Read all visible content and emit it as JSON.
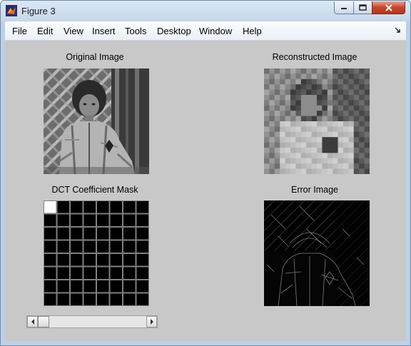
{
  "window": {
    "title": "Figure 3"
  },
  "menu": [
    "File",
    "Edit",
    "View",
    "Insert",
    "Tools",
    "Desktop",
    "Window",
    "Help"
  ],
  "panels": {
    "original": {
      "title": "Original Image"
    },
    "reconstructed": {
      "title": "Reconstructed Image"
    },
    "mask": {
      "title": "DCT Coefficient Mask",
      "grid_size": 8,
      "selected_cells": [
        [
          0,
          0
        ]
      ]
    },
    "error": {
      "title": "Error Image"
    }
  },
  "slider": {
    "value_fraction": 0.0
  },
  "colors": {
    "figure_bg": "#c8c8c8",
    "mask_cell_on": "#ffffff",
    "mask_cell_off": "#000000",
    "mask_grid": "#808080"
  }
}
